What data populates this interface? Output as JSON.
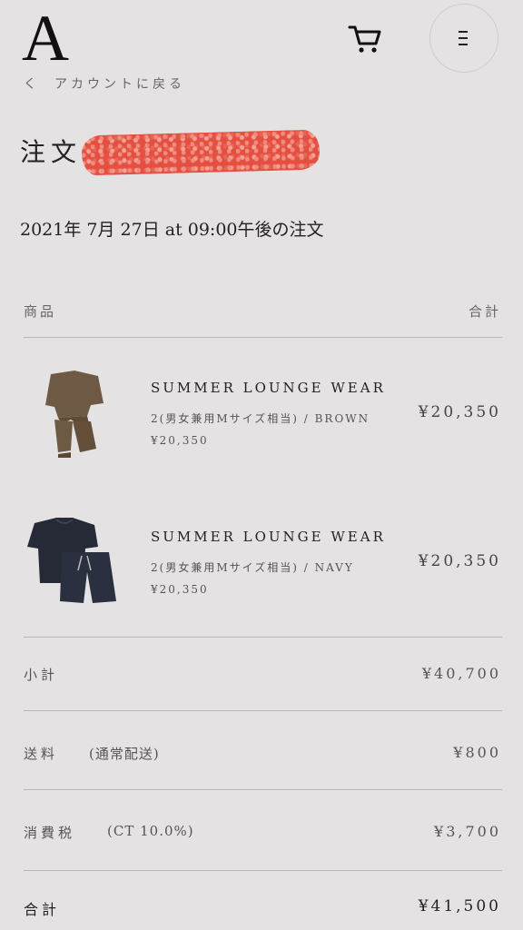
{
  "header": {
    "logo": "A",
    "back_label": "アカウントに戻る",
    "cart_icon": "cart-icon",
    "menu_icon": "menu-icon"
  },
  "order": {
    "title": "注文",
    "date_line": "2021年 7月 27日 at 09:00午後の注文"
  },
  "table": {
    "col_product": "商品",
    "col_total": "合計"
  },
  "items": [
    {
      "name": "SUMMER LOUNGE WEAR",
      "variant": "2(男女兼用Mサイズ相当) / BROWN",
      "unit_price": "¥20,350",
      "line_total": "¥20,350",
      "color": "#6e5a44"
    },
    {
      "name": "SUMMER LOUNGE WEAR",
      "variant": "2(男女兼用Mサイズ相当) / NAVY",
      "unit_price": "¥20,350",
      "line_total": "¥20,350",
      "color": "#252a36"
    }
  ],
  "summary": {
    "subtotal_label": "小計",
    "subtotal_value": "¥40,700",
    "shipping_label": "送料",
    "shipping_note": "(通常配送)",
    "shipping_value": "¥800",
    "tax_label": "消費税",
    "tax_note": "(CT 10.0%)",
    "tax_value": "¥3,700",
    "total_label": "合計",
    "total_value": "¥41,500"
  },
  "colors": {
    "background": "#e4e2e2",
    "redaction": "#e5483a"
  }
}
